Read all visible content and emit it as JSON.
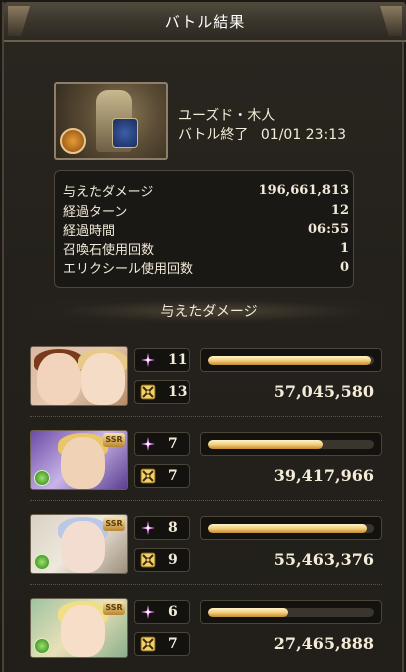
{
  "header": {
    "title": "バトル結果"
  },
  "boss": {
    "name": "ユーズド・木人",
    "battle_end_label": "バトル終了",
    "battle_end_time": "01/01 23:13"
  },
  "stats": [
    {
      "label": "与えたダメージ",
      "value": "196,661,813"
    },
    {
      "label": "経過ターン",
      "value": "12"
    },
    {
      "label": "経過時間",
      "value": "06:55"
    },
    {
      "label": "召喚石使用回数",
      "value": "1"
    },
    {
      "label": "エリクシール使用回数",
      "value": "0"
    }
  ],
  "damage_section": {
    "title": "与えたダメージ"
  },
  "characters": [
    {
      "name": "character-1",
      "skill_count": "11",
      "ougi_count": "13",
      "damage": "57,045,580",
      "bar_fill": 0.98,
      "ssr": false,
      "element": false
    },
    {
      "name": "character-2",
      "skill_count": "7",
      "ougi_count": "7",
      "damage": "39,417,966",
      "bar_fill": 0.69,
      "ssr": true,
      "ssr_label": "SSR",
      "element": true
    },
    {
      "name": "character-3",
      "skill_count": "8",
      "ougi_count": "9",
      "damage": "55,463,376",
      "bar_fill": 0.96,
      "ssr": true,
      "ssr_label": "SSR",
      "element": true
    },
    {
      "name": "character-4",
      "skill_count": "6",
      "ougi_count": "7",
      "damage": "27,465,888",
      "bar_fill": 0.48,
      "ssr": true,
      "ssr_label": "SSR",
      "element": true
    }
  ],
  "icons": {
    "skill": "pink-sparkle-icon",
    "ougi": "crossed-swords-icon",
    "element": "wind-element-icon"
  },
  "colors": {
    "bar": "#f3cf7d",
    "skill_icon": "#e88af0",
    "ougi_icon": "#e8c15a"
  }
}
